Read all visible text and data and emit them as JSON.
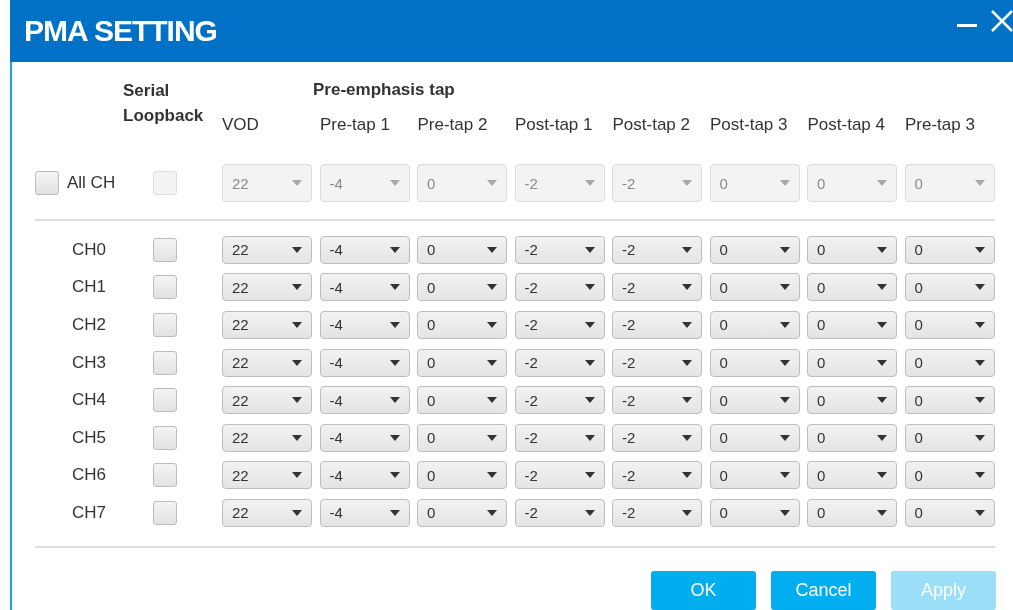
{
  "window": {
    "title": "PMA SETTING"
  },
  "header": {
    "serial_loopback": "Serial Loopback",
    "group_label": "Pre-emphasis tap",
    "columns": [
      "VOD",
      "Pre-tap 1",
      "Pre-tap 2",
      "Post-tap 1",
      "Post-tap 2",
      "Post-tap 3",
      "Post-tap 4",
      "Pre-tap 3"
    ]
  },
  "all_ch": {
    "label": "All CH",
    "checked": false,
    "loopback_checked": false,
    "disabled": true,
    "values": [
      "22",
      "-4",
      "0",
      "-2",
      "-2",
      "0",
      "0",
      "0"
    ]
  },
  "channels": [
    {
      "name": "CH0",
      "loopback_checked": false,
      "values": [
        "22",
        "-4",
        "0",
        "-2",
        "-2",
        "0",
        "0",
        "0"
      ]
    },
    {
      "name": "CH1",
      "loopback_checked": false,
      "values": [
        "22",
        "-4",
        "0",
        "-2",
        "-2",
        "0",
        "0",
        "0"
      ]
    },
    {
      "name": "CH2",
      "loopback_checked": false,
      "values": [
        "22",
        "-4",
        "0",
        "-2",
        "-2",
        "0",
        "0",
        "0"
      ]
    },
    {
      "name": "CH3",
      "loopback_checked": false,
      "values": [
        "22",
        "-4",
        "0",
        "-2",
        "-2",
        "0",
        "0",
        "0"
      ]
    },
    {
      "name": "CH4",
      "loopback_checked": false,
      "values": [
        "22",
        "-4",
        "0",
        "-2",
        "-2",
        "0",
        "0",
        "0"
      ]
    },
    {
      "name": "CH5",
      "loopback_checked": false,
      "values": [
        "22",
        "-4",
        "0",
        "-2",
        "-2",
        "0",
        "0",
        "0"
      ]
    },
    {
      "name": "CH6",
      "loopback_checked": false,
      "values": [
        "22",
        "-4",
        "0",
        "-2",
        "-2",
        "0",
        "0",
        "0"
      ]
    },
    {
      "name": "CH7",
      "loopback_checked": false,
      "values": [
        "22",
        "-4",
        "0",
        "-2",
        "-2",
        "0",
        "0",
        "0"
      ]
    }
  ],
  "buttons": [
    {
      "label": "OK",
      "disabled": false
    },
    {
      "label": "Cancel",
      "disabled": false
    },
    {
      "label": "Apply",
      "disabled": true
    }
  ]
}
